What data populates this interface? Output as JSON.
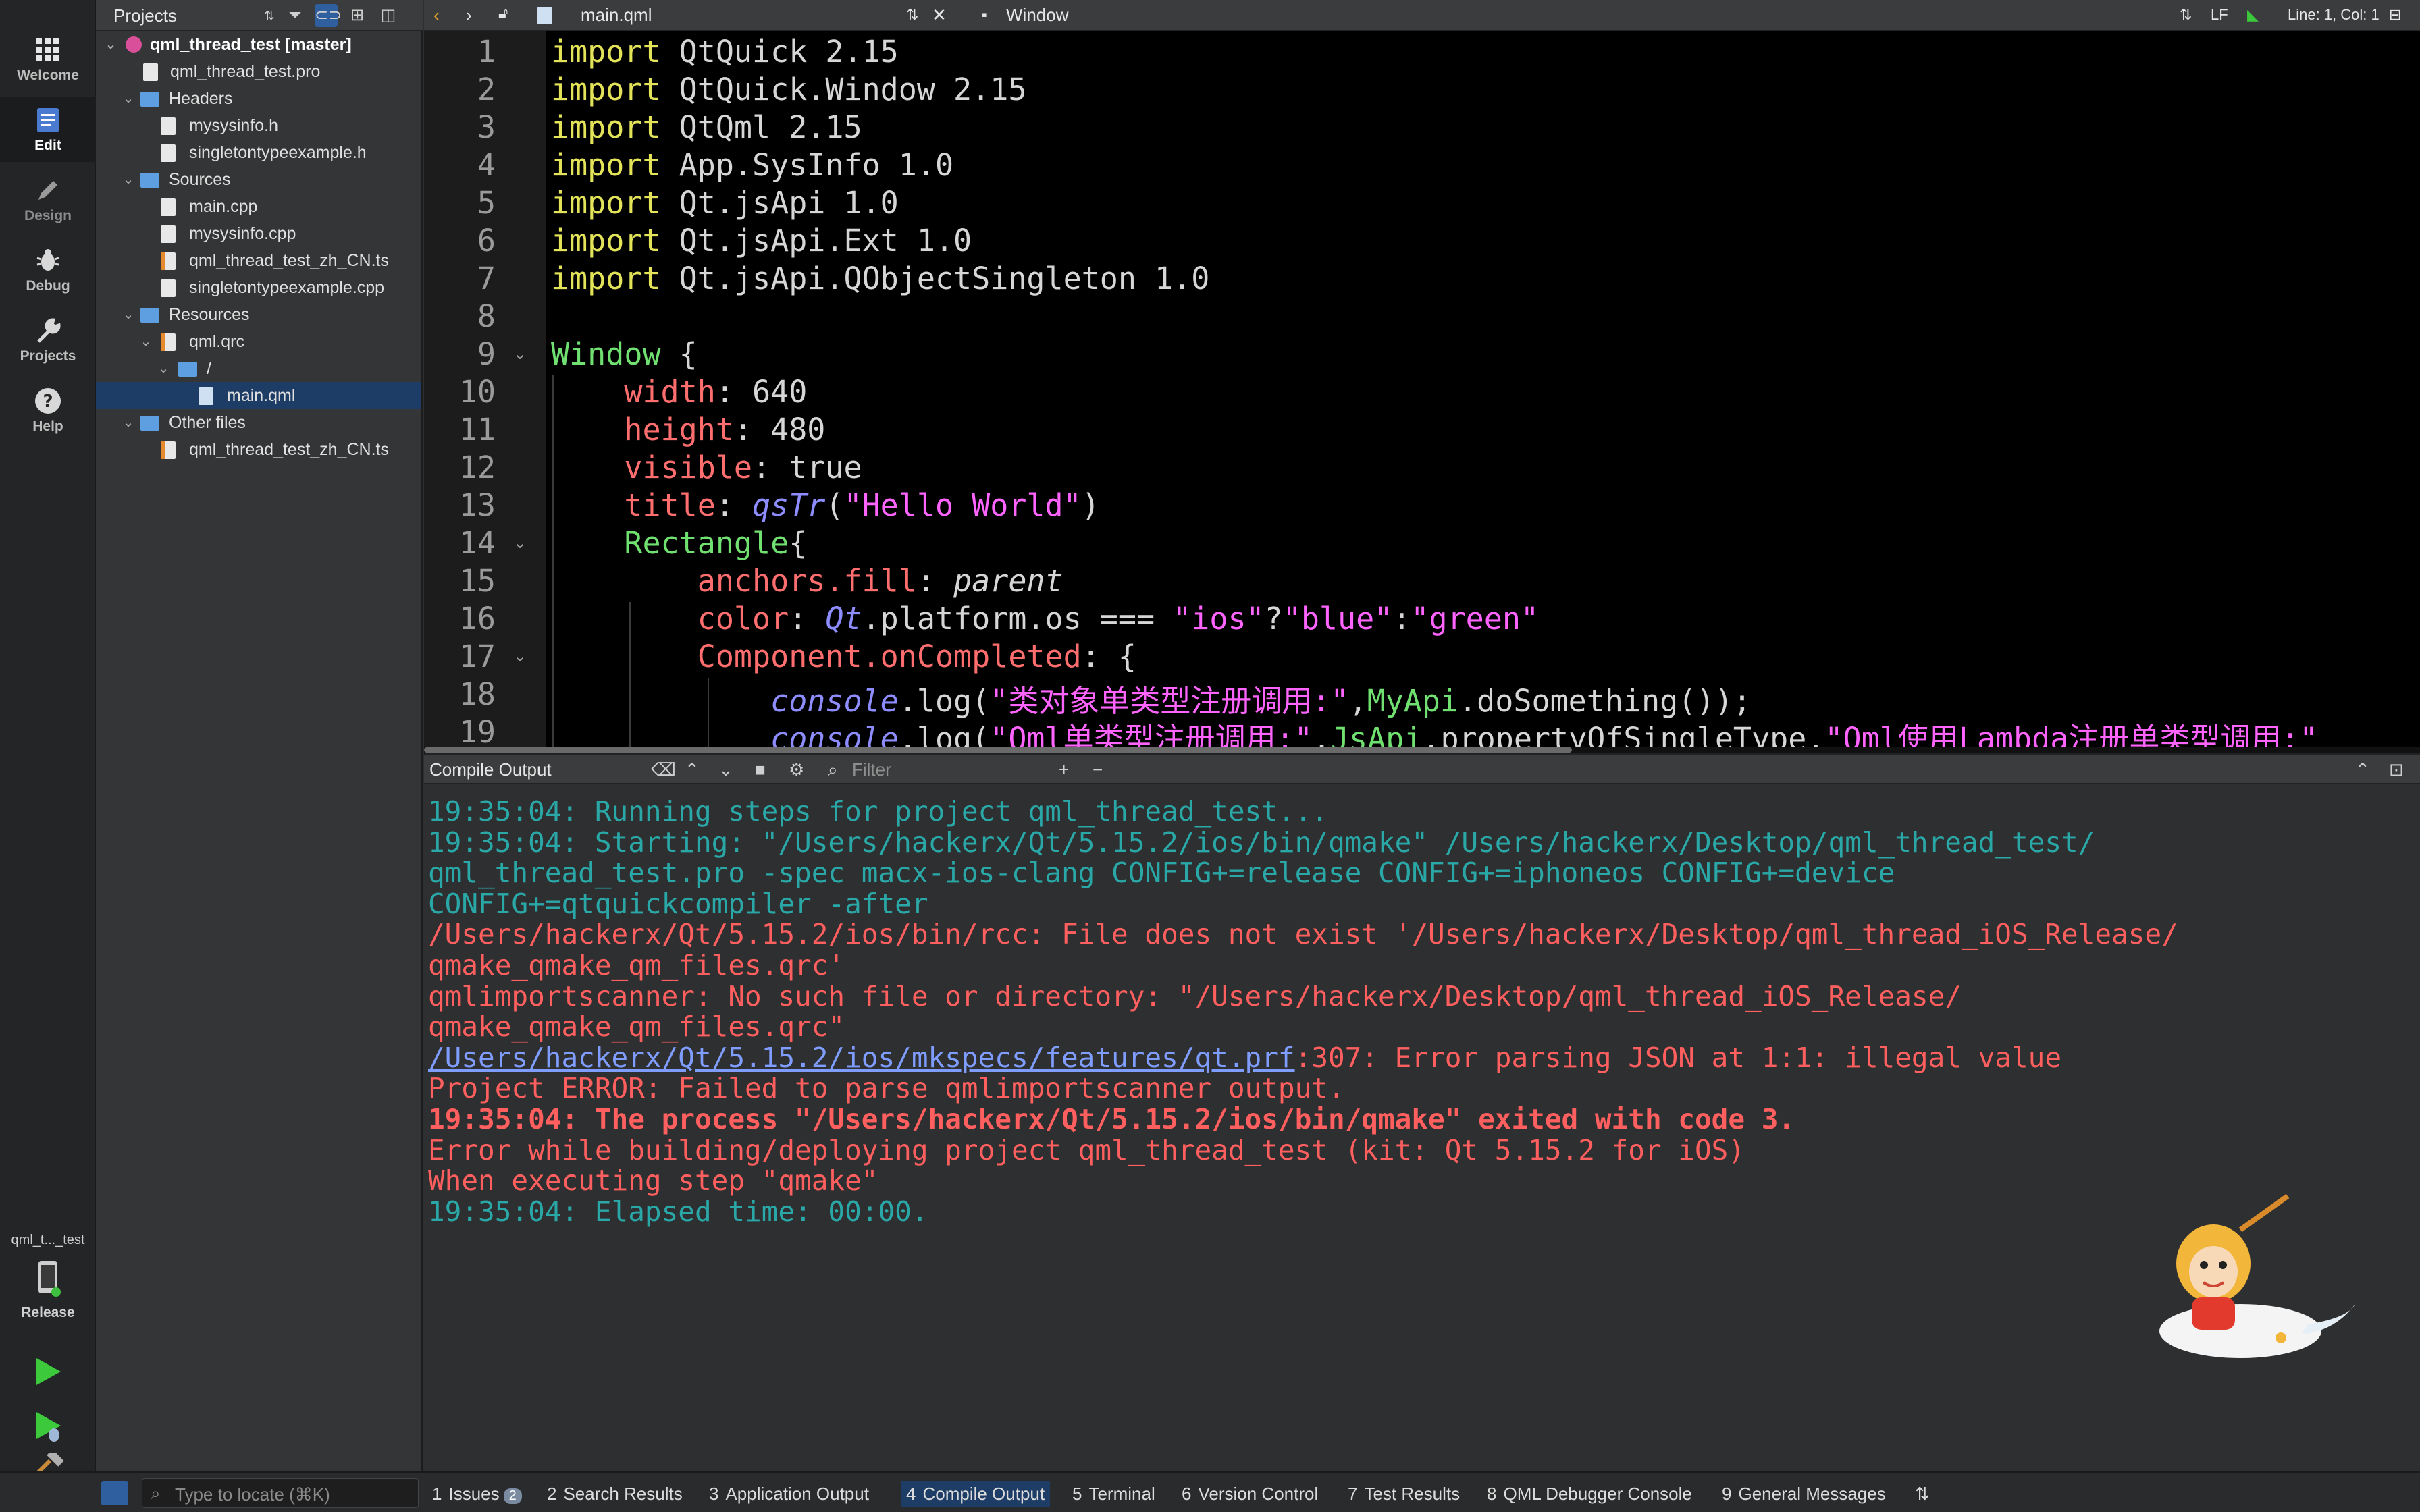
{
  "modes": [
    {
      "name": "welcome",
      "label": "Welcome",
      "icon": "grid-icon"
    },
    {
      "name": "edit",
      "label": "Edit",
      "icon": "document-icon"
    },
    {
      "name": "design",
      "label": "Design",
      "icon": "pencil-icon"
    },
    {
      "name": "debug",
      "label": "Debug",
      "icon": "bug-icon"
    },
    {
      "name": "projects",
      "label": "Projects",
      "icon": "wrench-icon"
    },
    {
      "name": "help",
      "label": "Help",
      "icon": "question-icon"
    }
  ],
  "kit": {
    "target_name": "qml_t..._test",
    "build_config": "Release"
  },
  "project_panel": {
    "title": "Projects",
    "tree": [
      {
        "label": "qml_thread_test [master]"
      },
      {
        "label": "qml_thread_test.pro"
      },
      {
        "label": "Headers"
      },
      {
        "label": "mysysinfo.h"
      },
      {
        "label": "singletontypeexample.h"
      },
      {
        "label": "Sources"
      },
      {
        "label": "main.cpp"
      },
      {
        "label": "mysysinfo.cpp"
      },
      {
        "label": "qml_thread_test_zh_CN.ts"
      },
      {
        "label": "singletontypeexample.cpp"
      },
      {
        "label": "Resources"
      },
      {
        "label": "qml.qrc"
      },
      {
        "label": "/"
      },
      {
        "label": "main.qml"
      },
      {
        "label": "Other files"
      },
      {
        "label": "qml_thread_test_zh_CN.ts"
      }
    ]
  },
  "editor_bar": {
    "file": "main.qml",
    "symbol": "Window",
    "line_ending": "LF",
    "cursor": "Line: 1, Col: 1"
  },
  "editor": {
    "line_numbers": [
      "1",
      "2",
      "3",
      "4",
      "5",
      "6",
      "7",
      "8",
      "9",
      "10",
      "11",
      "12",
      "13",
      "14",
      "15",
      "16",
      "17",
      "18",
      "19"
    ],
    "lines": [
      [
        "import",
        " QtQuick 2.15"
      ],
      [
        "import",
        " QtQuick.Window 2.15"
      ],
      [
        "import",
        " QtQml 2.15"
      ],
      [
        "import",
        " App.SysInfo 1.0"
      ],
      [
        "import",
        " Qt.jsApi 1.0"
      ],
      [
        "import",
        " Qt.jsApi.Ext 1.0"
      ],
      [
        "import",
        " Qt.jsApi.QObjectSingleton 1.0"
      ],
      [],
      [
        "Window",
        " {"
      ],
      [
        "width",
        ": 640"
      ],
      [
        "height",
        ": 480"
      ],
      [
        "visible",
        ": true"
      ],
      [
        "title",
        ": ",
        "qsTr",
        "(",
        "\"Hello World\"",
        ")"
      ],
      [
        "Rectangle",
        "{"
      ],
      [
        "anchors.fill",
        ": ",
        "parent"
      ],
      [
        "color",
        ": ",
        "Qt",
        ".platform.os === ",
        "\"ios\"",
        "?",
        "\"blue\"",
        ":",
        "\"green\""
      ],
      [
        "Component.onCompleted",
        ": {"
      ],
      [
        "console",
        ".log(",
        "\"类对象单类型注册调用:\"",
        ",",
        "MyApi",
        ".doSomething());"
      ],
      [
        "console",
        ".log(",
        "\"Qml单类型注册调用:\"",
        ",",
        "JsApi",
        ".propertyOfSingleType,",
        "\"Qml使用Lambda注册单类型调用:\""
      ]
    ]
  },
  "output_pane": {
    "title": "Compile Output",
    "filter_placeholder": "Filter",
    "lines": [
      {
        "style": "teal",
        "text": "19:35:04: Running steps for project qml_thread_test..."
      },
      {
        "style": "teal",
        "text": "19:35:04: Starting: \"/Users/hackerx/Qt/5.15.2/ios/bin/qmake\" /Users/hackerx/Desktop/qml_thread_test/"
      },
      {
        "style": "teal",
        "text": "qml_thread_test.pro -spec macx-ios-clang CONFIG+=release CONFIG+=iphoneos CONFIG+=device"
      },
      {
        "style": "teal",
        "text": "CONFIG+=qtquickcompiler -after"
      },
      {
        "style": "red",
        "text": "/Users/hackerx/Qt/5.15.2/ios/bin/rcc: File does not exist '/Users/hackerx/Desktop/qml_thread_iOS_Release/"
      },
      {
        "style": "red",
        "text": "qmake_qmake_qm_files.qrc'"
      },
      {
        "style": "red",
        "text": "qmlimportscanner: No such file or directory: \"/Users/hackerx/Desktop/qml_thread_iOS_Release/"
      },
      {
        "style": "red",
        "text": "qmake_qmake_qm_files.qrc\""
      },
      {
        "style": "link",
        "link": "/Users/hackerx/Qt/5.15.2/ios/mkspecs/features/qt.prf",
        "text": ":307: Error parsing JSON at 1:1: illegal value"
      },
      {
        "style": "red",
        "text": "Project ERROR: Failed to parse qmlimportscanner output."
      },
      {
        "style": "redb",
        "text": "19:35:04: The process \"/Users/hackerx/Qt/5.15.2/ios/bin/qmake\" exited with code 3."
      },
      {
        "style": "red",
        "text": "Error while building/deploying project qml_thread_test (kit: Qt 5.15.2 for iOS)"
      },
      {
        "style": "red",
        "text": "When executing step \"qmake\""
      },
      {
        "style": "teal",
        "text": "19:35:04: Elapsed time: 00:00."
      }
    ]
  },
  "status_bar": {
    "locator_placeholder": "Type to locate (⌘K)",
    "tabs": [
      {
        "num": "1",
        "label": "Issues",
        "badge": "2"
      },
      {
        "num": "2",
        "label": "Search Results"
      },
      {
        "num": "3",
        "label": "Application Output"
      },
      {
        "num": "4",
        "label": "Compile Output"
      },
      {
        "num": "5",
        "label": "Terminal"
      },
      {
        "num": "6",
        "label": "Version Control"
      },
      {
        "num": "7",
        "label": "Test Results"
      },
      {
        "num": "8",
        "label": "QML Debugger Console"
      },
      {
        "num": "9",
        "label": "General Messages"
      }
    ]
  },
  "colors": {
    "teal": "#2aa8a8",
    "error_red": "#ff5f5f",
    "selection": "#1e3d66",
    "editor_bg": "#000000"
  }
}
